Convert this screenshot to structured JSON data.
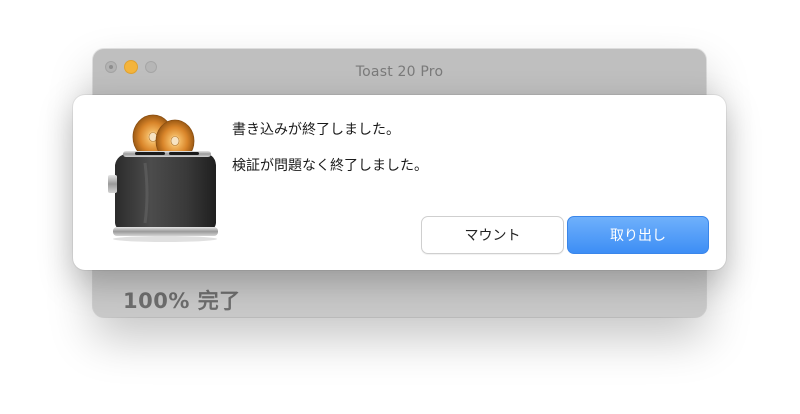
{
  "window": {
    "title": "Toast 20 Pro",
    "progress_text": "100% 完了"
  },
  "alert": {
    "message_primary": "書き込みが終了しました。",
    "message_secondary": "検証が問題なく終了しました。",
    "icon": "toaster-disc-icon",
    "buttons": {
      "mount_label": "マウント",
      "eject_label": "取り出し"
    }
  },
  "colors": {
    "accent": "#4a94f7",
    "minimize": "#f4b43c"
  }
}
